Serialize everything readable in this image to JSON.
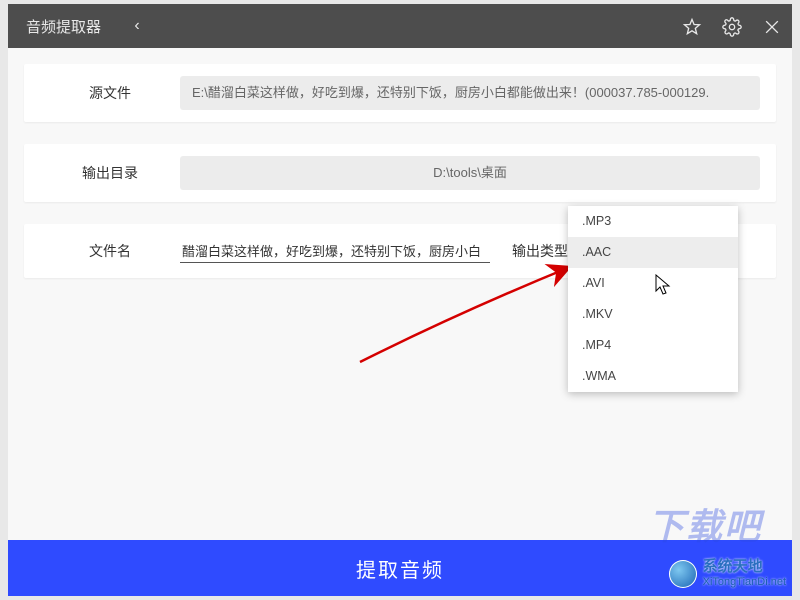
{
  "titlebar": {
    "title": "音频提取器",
    "back_glyph": "‹"
  },
  "source": {
    "label": "源文件",
    "value": "E:\\醋溜白菜这样做，好吃到爆，还特别下饭，厨房小白都能做出来！(000037.785-000129."
  },
  "output_dir": {
    "label": "输出目录",
    "value": "D:\\tools\\桌面"
  },
  "filename": {
    "label": "文件名",
    "value": "醋溜白菜这样做，好吃到爆，还特别下饭，厨房小白"
  },
  "output_type": {
    "label": "输出类型",
    "options": [
      ".MP3",
      ".AAC",
      ".AVI",
      ".MKV",
      ".MP4",
      ".WMA"
    ],
    "hover_index": 1
  },
  "extract_button": "提取音频",
  "watermark": {
    "line1": "系统天地",
    "line2": "XiTongTianDi.net"
  }
}
